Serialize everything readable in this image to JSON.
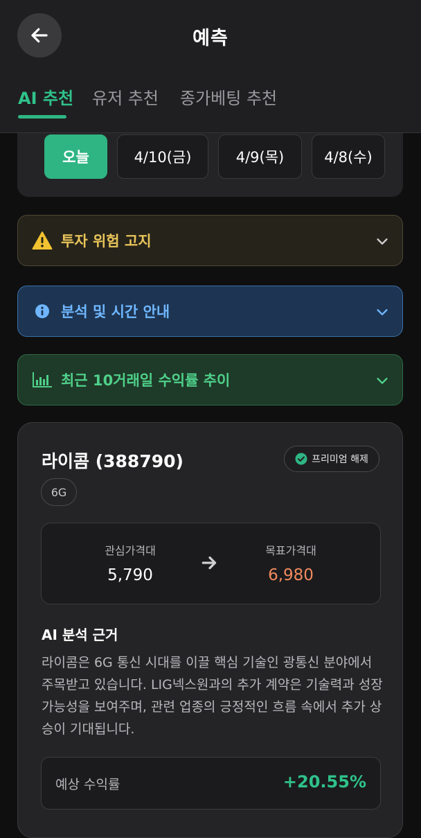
{
  "header": {
    "title": "예측",
    "back_icon": "arrow-left-icon"
  },
  "tabs": [
    {
      "label": "AI 추천",
      "active": true
    },
    {
      "label": "유저 추천",
      "active": false
    },
    {
      "label": "종가베팅 추천",
      "active": false
    }
  ],
  "dates": [
    {
      "label": "오늘",
      "active": true
    },
    {
      "label": "4/10(금)",
      "active": false
    },
    {
      "label": "4/9(목)",
      "active": false
    },
    {
      "label": "4/8(수)",
      "active": false
    }
  ],
  "accordions": {
    "warning": {
      "label": "투자 위험 고지",
      "icon": "warning-icon",
      "color": "#e8c45a"
    },
    "info": {
      "label": "분석 및 시간 안내",
      "icon": "info-icon",
      "color": "#6fb6ff"
    },
    "trend": {
      "label": "최근 10거래일 수익률 추이",
      "icon": "bar-chart-icon",
      "color": "#4fd08a"
    }
  },
  "stock": {
    "name": "라이콤 (388790)",
    "premium_label": "프리미엄 해제",
    "tag": "6G",
    "interest_label": "관심가격대",
    "interest_value": "5,790",
    "target_label": "목표가격대",
    "target_value": "6,980",
    "target_color": "#f08a5d",
    "analysis_title": "AI 분석 근거",
    "analysis_text": "라이콤은 6G 통신 시대를 이끌 핵심 기술인 광통신 분야에서 주목받고 있습니다. LIG넥스원과의 추가 계약은 기술력과 성장 가능성을 보여주며, 관련 업종의 긍정적인 흐름 속에서 추가 상승이 기대됩니다.",
    "return_label": "예상 수익률",
    "return_value": "+20.55%",
    "return_color": "#2fc28b"
  },
  "colors": {
    "accent": "#2fb584",
    "background": "#0f0f10",
    "surface": "#242426"
  }
}
